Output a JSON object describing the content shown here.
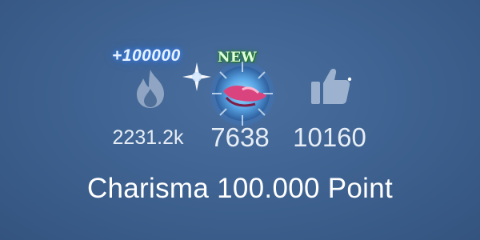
{
  "popularity": {
    "bonus": "+100000",
    "hot_count": "2231.2k",
    "gift_count": "7638",
    "likes_count": "10160",
    "new_badge": "NEW"
  },
  "reward": {
    "charisma_text": "Charisma 100.000 Point"
  },
  "icons": {
    "hot": "flame-icon",
    "gift": "gift-orb-icon",
    "likes": "thumbs-up-icon"
  },
  "colors": {
    "background": "#3f6392",
    "text": "#e6edf5",
    "bonus_glow": "#3d8cff",
    "badge_green": "#2d8a2d"
  }
}
